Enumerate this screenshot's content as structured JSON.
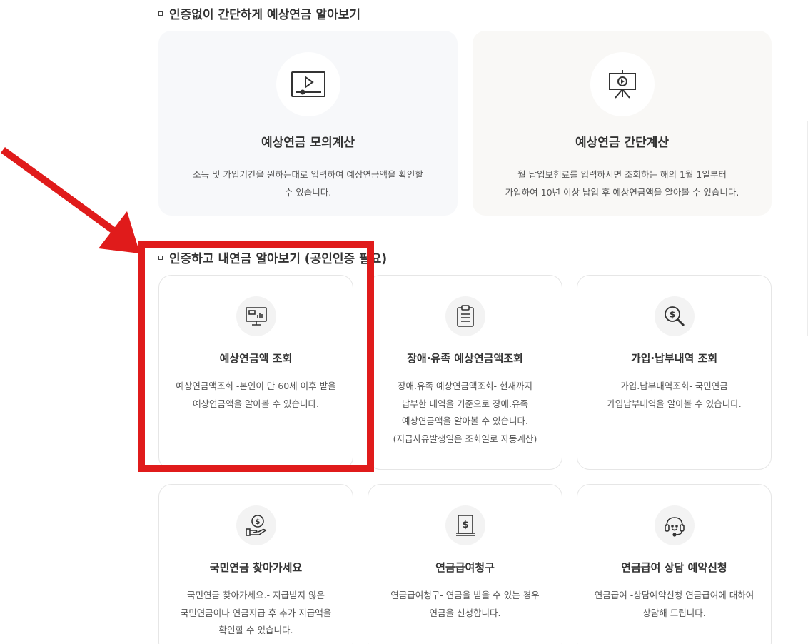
{
  "section1": {
    "title": "인증없이 간단하게 예상연금 알아보기",
    "cards": [
      {
        "title": "예상연금 모의계산",
        "desc_line1": "소득 및 가입기간을 원하는대로 입력하여 예상연금액을 확인할",
        "desc_line2": "수 있습니다.",
        "icon": "video-player-icon"
      },
      {
        "title": "예상연금 간단계산",
        "desc_line1": "월 납입보험료를 입력하시면 조회하는 해의 1월 1일부터",
        "desc_line2": "가입하여 10년 이상 납입 후 예상연금액을 알아볼 수 있습니다.",
        "icon": "presentation-board-icon"
      }
    ]
  },
  "section2": {
    "title": "인증하고 내연금 알아보기 (공인인증 필요)",
    "cards": [
      {
        "title": "예상연금액 조회",
        "lines": [
          "예상연금액조회 -본인이 만 60세 이후 받을",
          "예상연금액을 알아볼 수 있습니다."
        ],
        "icon": "monitor-chart-icon"
      },
      {
        "title": "장애·유족 예상연금액조회",
        "lines": [
          "장애.유족 예상연금액조회- 현재까지",
          "납부한 내역을 기준으로 장애.유족",
          "예상연금액을 알아볼 수 있습니다.",
          "(지급사유발생일은 조회일로 자동계산)"
        ],
        "icon": "clipboard-icon"
      },
      {
        "title": "가입·납부내역 조회",
        "lines": [
          "가입.납부내역조회- 국민연금",
          "가입납부내역을 알아볼 수 있습니다."
        ],
        "icon": "dollar-search-icon"
      },
      {
        "title": "국민연금 찾아가세요",
        "lines": [
          "국민연금 찾아가세요.- 지급받지 않은",
          "국민연금이나 연금지급 후 추가 지급액을",
          "확인할 수 있습니다."
        ],
        "icon": "hand-coin-icon"
      },
      {
        "title": "연금급여청구",
        "lines": [
          "연금급여청구- 연금을 받을 수 있는 경우",
          "연금을 신청합니다."
        ],
        "icon": "dollar-document-icon"
      },
      {
        "title": "연금급여 상담 예약신청",
        "lines": [
          "연금급여 -상담예약신청 연금급여에 대하여",
          "상담해 드립니다."
        ],
        "icon": "headset-icon"
      }
    ]
  },
  "annotation": {
    "color": "#e01b1b"
  }
}
